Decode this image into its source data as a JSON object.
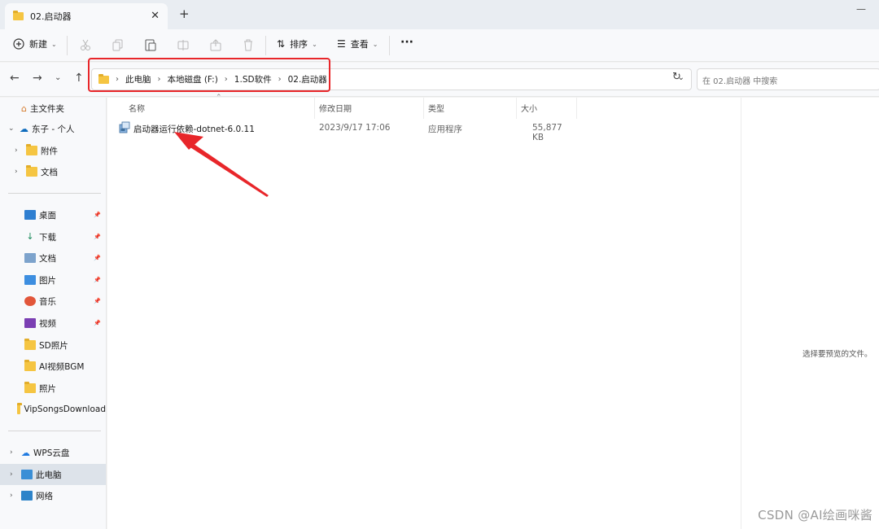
{
  "tab": {
    "title": "02.启动器",
    "close": "✕",
    "new_tab": "+"
  },
  "window": {
    "minimize": "—"
  },
  "toolbar": {
    "new_label": "新建",
    "sort_label": "排序",
    "view_label": "查看",
    "more": "···"
  },
  "address": {
    "crumbs": [
      "此电脑",
      "本地磁盘 (F:)",
      "1.SD软件",
      "02.启动器"
    ],
    "search_placeholder": "在 02.启动器 中搜索"
  },
  "sidebar": {
    "home": "主文件夹",
    "cloud": "东子 - 个人",
    "cloud_children": [
      "附件",
      "文档"
    ],
    "quick": [
      {
        "label": "桌面",
        "icon": "desktop-icon",
        "pinned": true
      },
      {
        "label": "下载",
        "icon": "download-icon",
        "pinned": true
      },
      {
        "label": "文档",
        "icon": "document-icon",
        "pinned": true
      },
      {
        "label": "图片",
        "icon": "picture-icon",
        "pinned": true
      },
      {
        "label": "音乐",
        "icon": "music-icon",
        "pinned": true
      },
      {
        "label": "视频",
        "icon": "video-icon",
        "pinned": true
      },
      {
        "label": "SD照片",
        "icon": "folder-icon",
        "pinned": false
      },
      {
        "label": "AI视频BGM",
        "icon": "folder-icon",
        "pinned": false
      },
      {
        "label": "照片",
        "icon": "folder-icon",
        "pinned": false
      },
      {
        "label": "VipSongsDownload",
        "icon": "folder-icon",
        "pinned": false
      }
    ],
    "bottom": [
      "WPS云盘",
      "此电脑",
      "网络"
    ]
  },
  "columns": {
    "name": "名称",
    "modified": "修改日期",
    "type": "类型",
    "size": "大小"
  },
  "files": [
    {
      "name": "启动器运行依赖-dotnet-6.0.11",
      "modified": "2023/9/17 17:06",
      "type": "应用程序",
      "size": "55,877 KB"
    }
  ],
  "preview": {
    "empty_text": "选择要预览的文件。"
  },
  "watermark": "CSDN @AI绘画咪酱",
  "colors": {
    "highlight": "#e8262a",
    "folder": "#f5c542",
    "accent": "#0067c0"
  }
}
